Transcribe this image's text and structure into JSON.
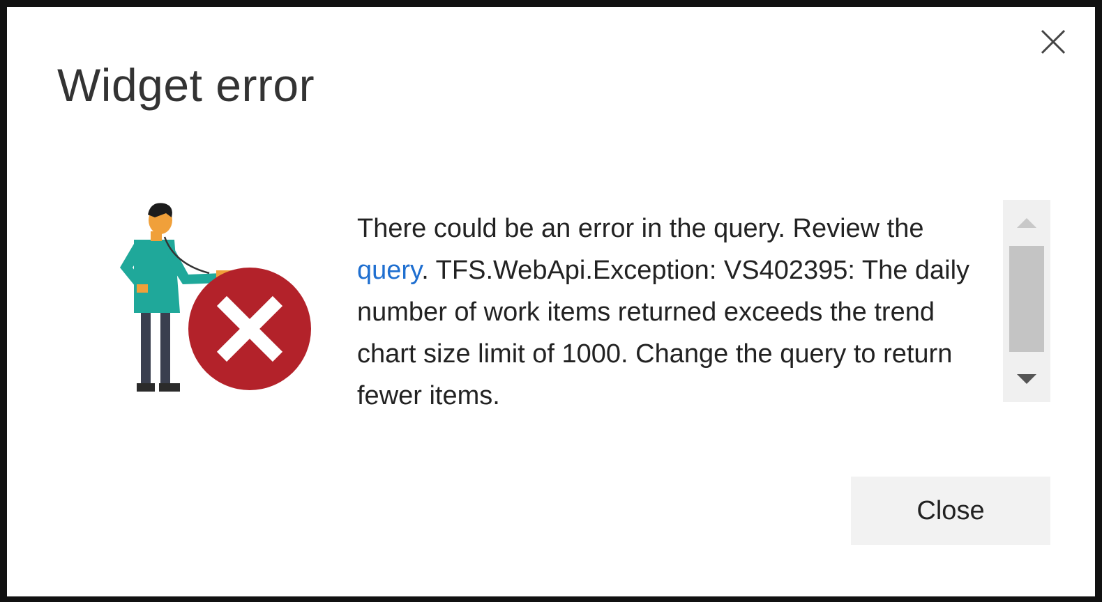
{
  "dialog": {
    "title": "Widget error",
    "message_part1": "There could be an error in the query. Review the ",
    "message_link": "query",
    "message_part2": ". TFS.WebApi.Exception: VS402395: The daily number of work items returned exceeds the trend chart size limit of 1000. Change the query to return fewer items.",
    "close_button_label": "Close"
  },
  "icons": {
    "close": "close-icon",
    "illustration": "doctor-error-illustration",
    "error": "error-x-icon",
    "scroll_up": "scroll-up-arrow-icon",
    "scroll_down": "scroll-down-arrow-icon"
  },
  "colors": {
    "error_red": "#b3222a",
    "link_blue": "#1f6fd0",
    "shirt_teal": "#1fa89a",
    "button_bg": "#f2f2f2",
    "scroll_track": "#f0f0f0",
    "scroll_thumb": "#c4c4c4"
  }
}
